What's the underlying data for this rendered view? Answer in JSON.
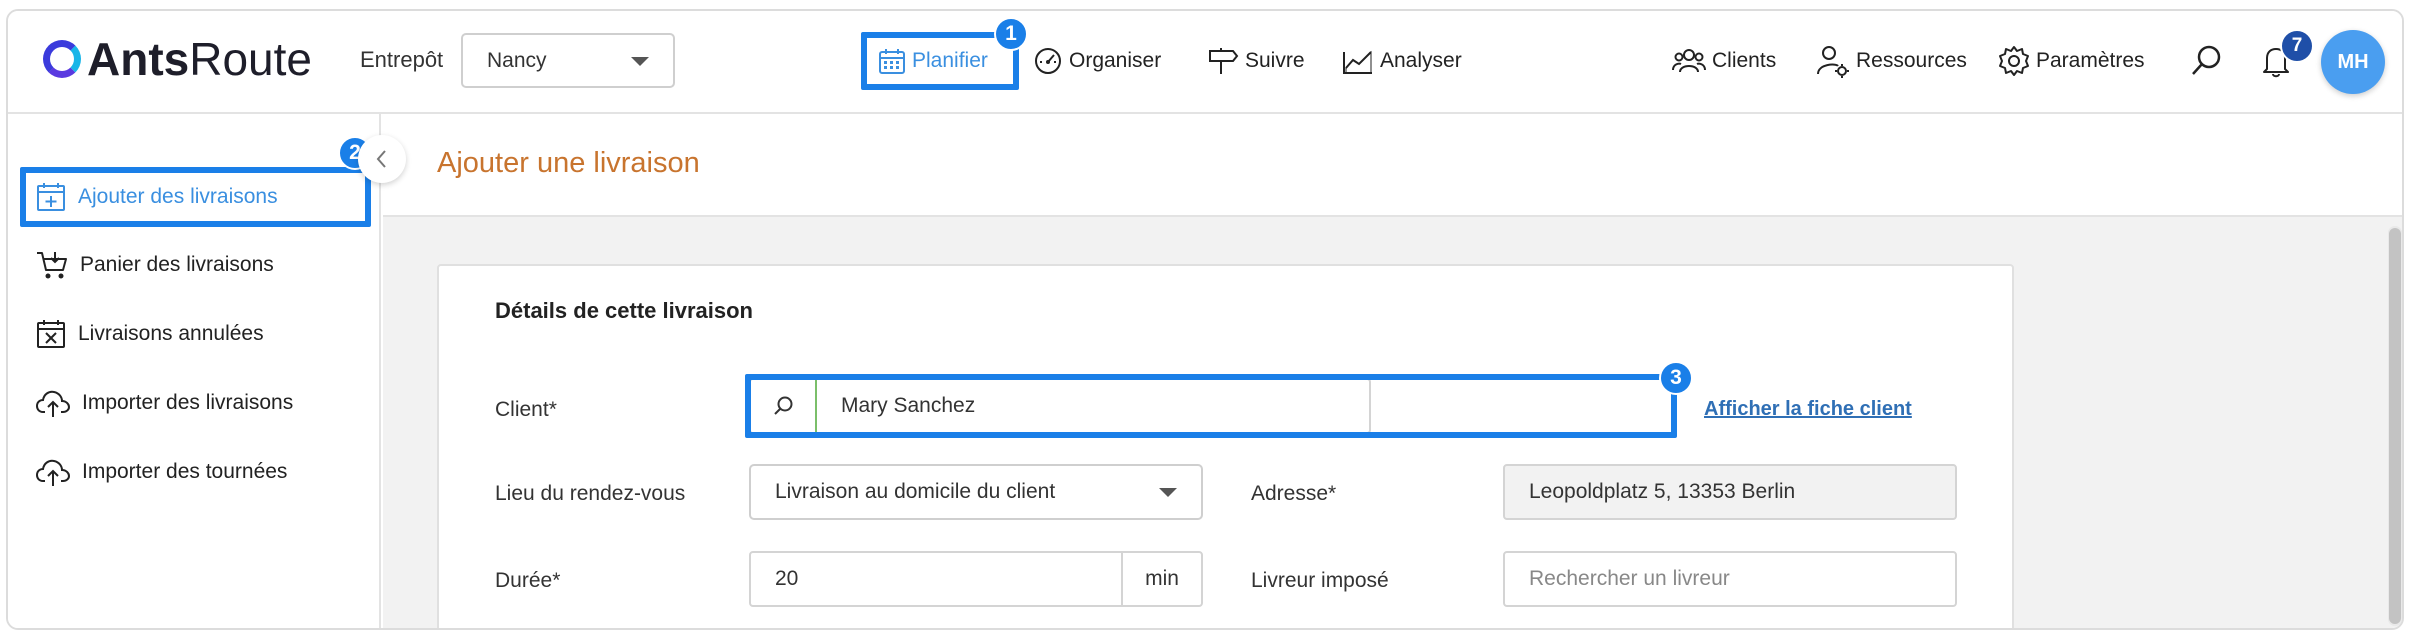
{
  "app": {
    "brand_bold": "Ants",
    "brand_light": "Route"
  },
  "header": {
    "entrepot_label": "Entrepôt",
    "entrepot_value": "Nancy",
    "nav": {
      "planifier": "Planifier",
      "organiser": "Organiser",
      "suivre": "Suivre",
      "analyser": "Analyser",
      "clients": "Clients",
      "ressources": "Ressources",
      "parametres": "Paramètres"
    },
    "notifications_count": "7",
    "user_initials": "MH"
  },
  "annotations": {
    "badge1": "1",
    "badge2": "2",
    "badge3": "3"
  },
  "sidebar": {
    "items": [
      {
        "label": "Ajouter des livraisons",
        "icon": "calendar-plus-icon"
      },
      {
        "label": "Panier des livraisons",
        "icon": "cart-icon"
      },
      {
        "label": "Livraisons annulées",
        "icon": "calendar-x-icon"
      },
      {
        "label": "Importer des livraisons",
        "icon": "cloud-upload-icon"
      },
      {
        "label": "Importer des tournées",
        "icon": "cloud-upload-icon"
      }
    ]
  },
  "page": {
    "title": "Ajouter une livraison",
    "card_title": "Détails de cette livraison",
    "form": {
      "client_label": "Client*",
      "client_value": "Mary Sanchez",
      "client_link": "Afficher la fiche client",
      "lieu_label": "Lieu du rendez-vous",
      "lieu_value": "Livraison au domicile du client",
      "adresse_label": "Adresse*",
      "adresse_value": "Leopoldplatz 5, 13353 Berlin",
      "duree_label": "Durée*",
      "duree_value": "20",
      "duree_unit": "min",
      "livreur_label": "Livreur imposé",
      "livreur_placeholder": "Rechercher un livreur"
    }
  },
  "colors": {
    "accent": "#1a7fe8",
    "title_orange": "#c8742e",
    "link": "#2f6fb5",
    "avatar": "#4a9ef0"
  }
}
